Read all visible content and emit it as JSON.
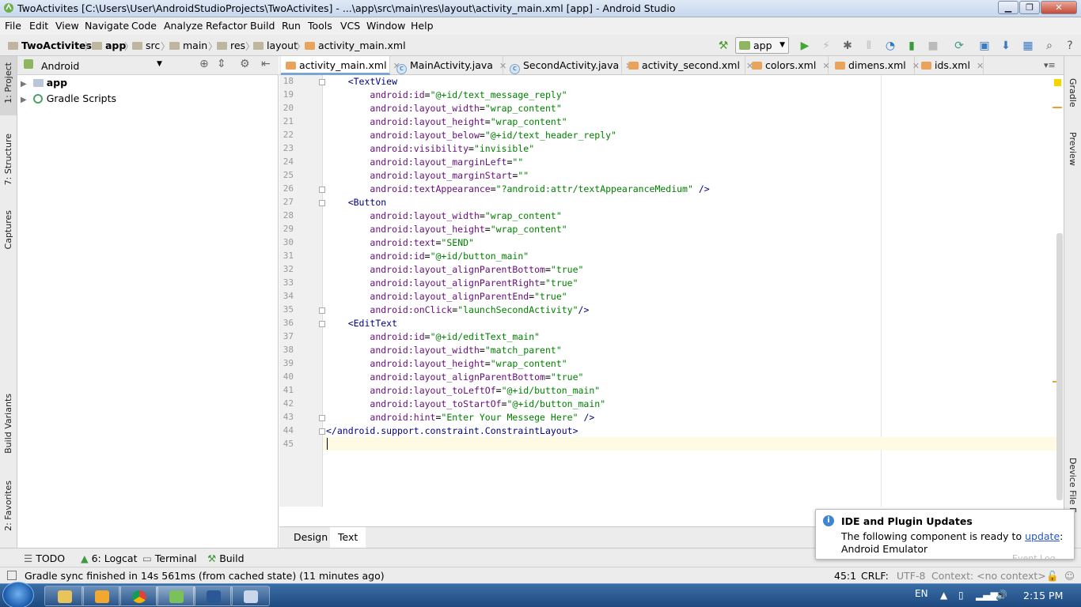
{
  "window": {
    "title": "TwoActivites [C:\\Users\\User\\AndroidStudioProjects\\TwoActivites] - ...\\app\\src\\main\\res\\layout\\activity_main.xml [app] - Android Studio"
  },
  "menu": [
    "File",
    "Edit",
    "View",
    "Navigate",
    "Code",
    "Analyze",
    "Refactor",
    "Build",
    "Run",
    "Tools",
    "VCS",
    "Window",
    "Help"
  ],
  "breadcrumb": [
    "TwoActivites",
    "app",
    "src",
    "main",
    "res",
    "layout",
    "activity_main.xml"
  ],
  "toolbar": {
    "run_config": "app"
  },
  "left_tool_tabs": [
    "1: Project",
    "7: Structure",
    "Captures",
    "Build Variants",
    "2: Favorites"
  ],
  "right_tool_tabs": [
    "Gradle",
    "Preview",
    "Device File E"
  ],
  "project_panel": {
    "view_mode": "Android",
    "items": [
      "app",
      "Gradle Scripts"
    ]
  },
  "editor_tabs": [
    {
      "label": "activity_main.xml",
      "type": "xml",
      "active": true
    },
    {
      "label": "MainActivity.java",
      "type": "java",
      "active": false
    },
    {
      "label": "SecondActivity.java",
      "type": "java",
      "active": false
    },
    {
      "label": "activity_second.xml",
      "type": "xml",
      "active": false
    },
    {
      "label": "colors.xml",
      "type": "xml",
      "active": false
    },
    {
      "label": "dimens.xml",
      "type": "xml",
      "active": false
    },
    {
      "label": "ids.xml",
      "type": "xml",
      "active": false
    }
  ],
  "code_lines": [
    {
      "n": "18",
      "text": "    <TextView"
    },
    {
      "n": "19",
      "text": "        android:id=\"@+id/text_message_reply\""
    },
    {
      "n": "20",
      "text": "        android:layout_width=\"wrap_content\""
    },
    {
      "n": "21",
      "text": "        android:layout_height=\"wrap_content\""
    },
    {
      "n": "22",
      "text": "        android:layout_below=\"@+id/text_header_reply\""
    },
    {
      "n": "23",
      "text": "        android:visibility=\"invisible\""
    },
    {
      "n": "24",
      "text": "        android:layout_marginLeft=\"\""
    },
    {
      "n": "25",
      "text": "        android:layout_marginStart=\"\""
    },
    {
      "n": "26",
      "text": "        android:textAppearance=\"?android:attr/textAppearanceMedium\" />"
    },
    {
      "n": "27",
      "text": "    <Button"
    },
    {
      "n": "28",
      "text": "        android:layout_width=\"wrap_content\""
    },
    {
      "n": "29",
      "text": "        android:layout_height=\"wrap_content\""
    },
    {
      "n": "30",
      "text": "        android:text=\"SEND\""
    },
    {
      "n": "31",
      "text": "        android:id=\"@+id/button_main\""
    },
    {
      "n": "32",
      "text": "        android:layout_alignParentBottom=\"true\""
    },
    {
      "n": "33",
      "text": "        android:layout_alignParentRight=\"true\""
    },
    {
      "n": "34",
      "text": "        android:layout_alignParentEnd=\"true\""
    },
    {
      "n": "35",
      "text": "        android:onClick=\"launchSecondActivity\"/>"
    },
    {
      "n": "36",
      "text": "    <EditText"
    },
    {
      "n": "37",
      "text": "        android:id=\"@+id/editText_main\""
    },
    {
      "n": "38",
      "text": "        android:layout_width=\"match_parent\""
    },
    {
      "n": "39",
      "text": "        android:layout_height=\"wrap_content\""
    },
    {
      "n": "40",
      "text": "        android:layout_alignParentBottom=\"true\""
    },
    {
      "n": "41",
      "text": "        android:layout_toLeftOf=\"@+id/button_main\""
    },
    {
      "n": "42",
      "text": "        android:layout_toStartOf=\"@+id/button_main\""
    },
    {
      "n": "43",
      "text": "        android:hint=\"Enter Your Messege Here\" />"
    },
    {
      "n": "44",
      "text": "</android.support.constraint.ConstraintLayout>"
    },
    {
      "n": "45",
      "text": ""
    }
  ],
  "bottom_tabs": [
    "Design",
    "Text"
  ],
  "tool_windows": [
    "TODO",
    "6: Logcat",
    "Terminal",
    "Build"
  ],
  "status": {
    "message": "Gradle sync finished in 14s 561ms (from cached state) (11 minutes ago)",
    "position": "45:1",
    "line_sep": "CRLF:",
    "encoding": "UTF-8",
    "context": "Context: <no context>"
  },
  "notification": {
    "title": "IDE and Plugin Updates",
    "body": "The following component is ready to",
    "link": "update",
    "body_end": ":",
    "component": "Android Emulator",
    "behind": "Event Log"
  },
  "taskbar": {
    "lang": "EN",
    "time": "2:15 PM"
  },
  "colors": {
    "tag": "#000080",
    "attr": "#660e7a",
    "value": "#008000",
    "accent": "#3f86d2"
  }
}
